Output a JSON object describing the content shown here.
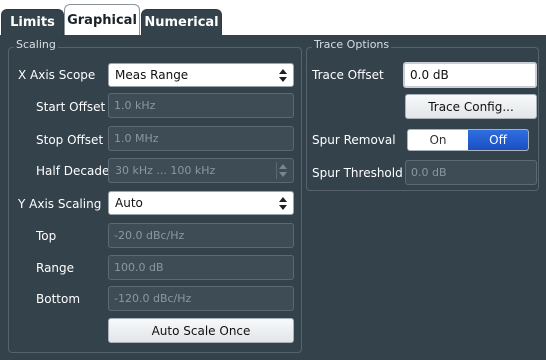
{
  "tabs": [
    {
      "label": "Limits"
    },
    {
      "label": "Graphical"
    },
    {
      "label": "Numerical"
    }
  ],
  "scaling": {
    "title": "Scaling",
    "x_axis_scope": {
      "label": "X Axis Scope",
      "value": "Meas Range"
    },
    "start_offset": {
      "label": "Start Offset",
      "value": "1.0 kHz"
    },
    "stop_offset": {
      "label": "Stop Offset",
      "value": "1.0 MHz"
    },
    "half_decade": {
      "label": "Half Decade",
      "value": "30 kHz ... 100 kHz"
    },
    "y_axis_scaling": {
      "label": "Y Axis Scaling",
      "value": "Auto"
    },
    "top": {
      "label": "Top",
      "value": "-20.0 dBc/Hz"
    },
    "range": {
      "label": "Range",
      "value": "100.0 dB"
    },
    "bottom": {
      "label": "Bottom",
      "value": "-120.0 dBc/Hz"
    },
    "auto_scale_once": "Auto Scale Once"
  },
  "trace_options": {
    "title": "Trace Options",
    "trace_offset": {
      "label": "Trace Offset",
      "value": "0.0 dB"
    },
    "trace_config": "Trace Config...",
    "spur_removal": {
      "label": "Spur Removal",
      "on": "On",
      "off": "Off",
      "selected": "Off"
    },
    "spur_threshold": {
      "label": "Spur Threshold",
      "value": "0.0 dB"
    }
  },
  "colors": {
    "panel": "#34424c",
    "accent": "#1b4fc4"
  }
}
